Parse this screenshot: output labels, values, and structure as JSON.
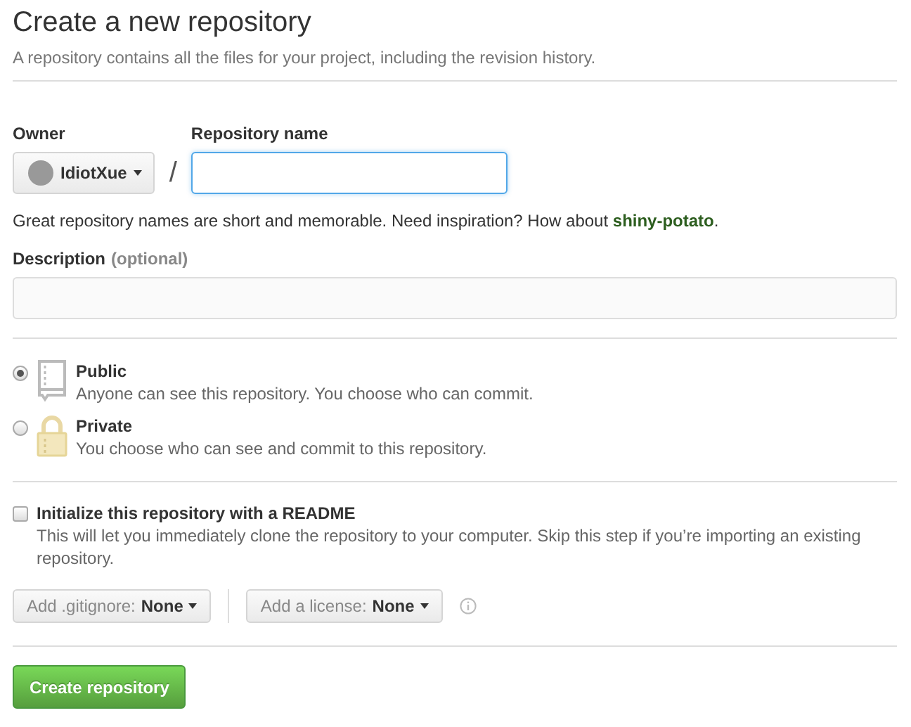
{
  "header": {
    "title": "Create a new repository",
    "subtitle": "A repository contains all the files for your project, including the revision history."
  },
  "owner": {
    "label": "Owner",
    "name": "IdiotXue"
  },
  "separator": "/",
  "repository_name": {
    "label": "Repository name"
  },
  "name_hint": "Great repository names are short and memorable. Need inspiration? How about **shiny-potato**.",
  "description": {
    "label": "Description",
    "hint": "(optional)"
  },
  "visibility": [
    {
      "kind": "public",
      "label": "Public",
      "text": "Anyone can see this repository. You choose who can commit.",
      "selected": true
    },
    {
      "kind": "private",
      "label": "Private",
      "text": "You choose who can see and commit to this repository.",
      "selected": false
    }
  ],
  "readme": {
    "label": "Initialize this repository with a README",
    "text": "This will let you immediately clone the repository to your computer. Skip this step if you’re importing an existing repository.",
    "checked": false
  },
  "dropdowns": [
    {
      "label": "Add .gitignore:",
      "value": "None"
    },
    {
      "label": "Add a license:",
      "value": "None"
    }
  ],
  "submit": "Create repository"
}
